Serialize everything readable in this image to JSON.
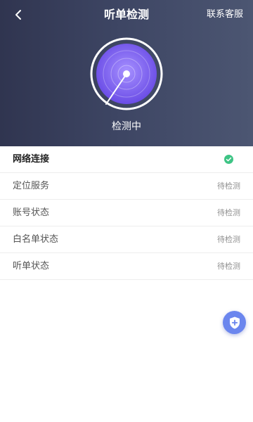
{
  "header": {
    "title": "听单检测",
    "contact_link": "联系客服",
    "back_icon": "chevron-left-icon"
  },
  "scanner": {
    "status": "检测中",
    "accent_color": "#7b5ff0"
  },
  "checks": [
    {
      "label": "网络连接",
      "status": "",
      "state": "passed"
    },
    {
      "label": "定位服务",
      "status": "待检测",
      "state": "pending"
    },
    {
      "label": "账号状态",
      "status": "待检测",
      "state": "pending"
    },
    {
      "label": "白名单状态",
      "status": "待检测",
      "state": "pending"
    },
    {
      "label": "听单状态",
      "status": "待检测",
      "state": "pending"
    }
  ],
  "colors": {
    "success": "#3ec485",
    "fab": "#6b86ee"
  },
  "fab": {
    "icon": "shield-plus-icon"
  }
}
